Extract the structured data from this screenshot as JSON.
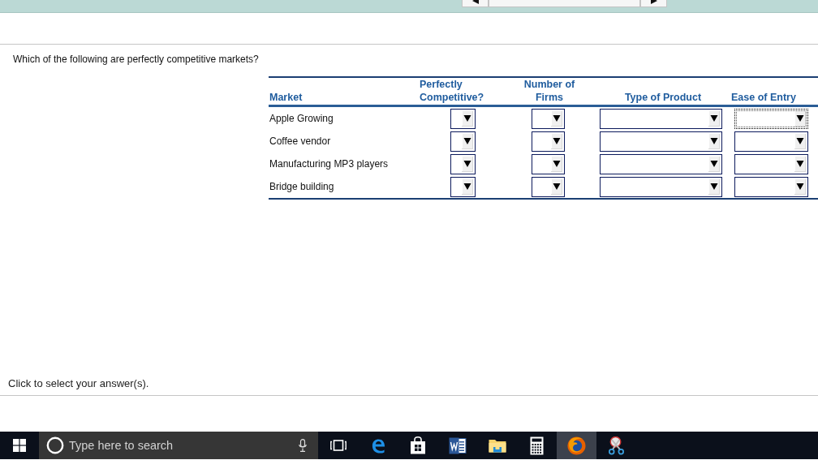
{
  "top_bar": {
    "nav": [
      {
        "kind": "prev"
      },
      {
        "kind": "menu"
      },
      {
        "kind": "next"
      }
    ]
  },
  "question": "Which of the following are perfectly competitive markets?",
  "table": {
    "columns": [
      "Market",
      "Perfectly Competitive?",
      "Number of Firms",
      "Type of Product",
      "Ease of Entry"
    ],
    "rows": [
      {
        "market": "Apple Growing",
        "answers": [
          {
            "focused": false
          },
          {
            "focused": false
          },
          {
            "focused": false
          },
          {
            "focused": true
          }
        ]
      },
      {
        "market": "Coffee vendor",
        "answers": [
          {
            "focused": false
          },
          {
            "focused": false
          },
          {
            "focused": false
          },
          {
            "focused": false
          }
        ]
      },
      {
        "market": "Manufacturing MP3 players",
        "answers": [
          {
            "focused": false
          },
          {
            "focused": false
          },
          {
            "focused": false
          },
          {
            "focused": false
          }
        ]
      },
      {
        "market": "Bridge building",
        "answers": [
          {
            "focused": false
          },
          {
            "focused": false
          },
          {
            "focused": false
          },
          {
            "focused": false
          }
        ]
      }
    ]
  },
  "instruction": "Click to select your answer(s).",
  "taskbar": {
    "search": {
      "placeholder": "Type here to search"
    },
    "apps": [
      {
        "kind": "task-view",
        "active": false
      },
      {
        "kind": "edge",
        "active": false
      },
      {
        "kind": "store",
        "active": false
      },
      {
        "kind": "word",
        "active": false
      },
      {
        "kind": "folder",
        "active": false
      },
      {
        "kind": "calculator",
        "active": false
      },
      {
        "kind": "firefox",
        "active": true
      },
      {
        "kind": "snip",
        "active": false
      }
    ]
  }
}
